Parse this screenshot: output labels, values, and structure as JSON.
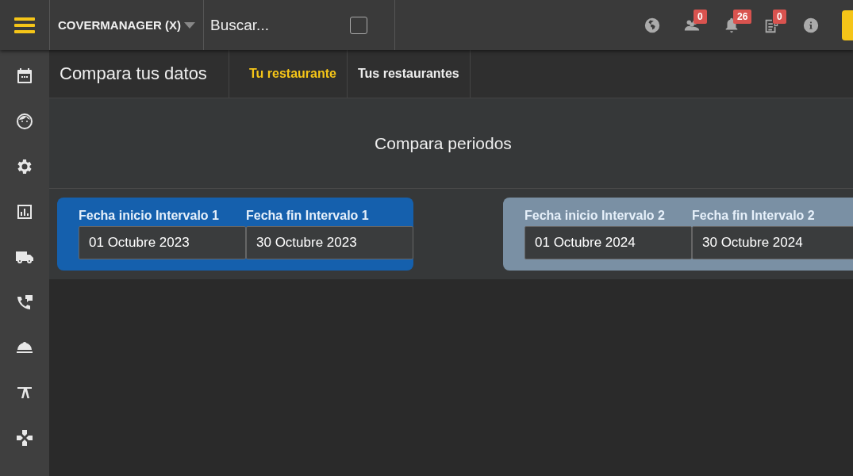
{
  "topbar": {
    "account": "COVERMANAGER (X)",
    "search": {
      "placeholder": "Buscar..."
    },
    "checkbox": {
      "checked": false
    },
    "badges": [
      {
        "kind": "people",
        "count": "0"
      },
      {
        "kind": "bell",
        "count": "26"
      },
      {
        "kind": "clipboard",
        "count": "0"
      }
    ]
  },
  "header": {
    "title": "Compara tus datos",
    "tabs": [
      {
        "label": "Tu restaurante",
        "selected": true
      },
      {
        "label": "Tus restaurantes",
        "selected": false
      }
    ]
  },
  "section_title": "Compara periodos",
  "intervals": [
    {
      "color": "#1560ad",
      "start_label": "Fecha inicio Intervalo 1",
      "start": "01 Octubre 2023",
      "end_label": "Fecha fin Intervalo 1",
      "end": "30 Octubre 2023"
    },
    {
      "color": "#7a90a4",
      "start_label": "Fecha inicio Intervalo 2",
      "start": "01 Octubre 2024",
      "end_label": "Fecha fin Intervalo 2",
      "end": "30 Octubre 2024"
    }
  ]
}
